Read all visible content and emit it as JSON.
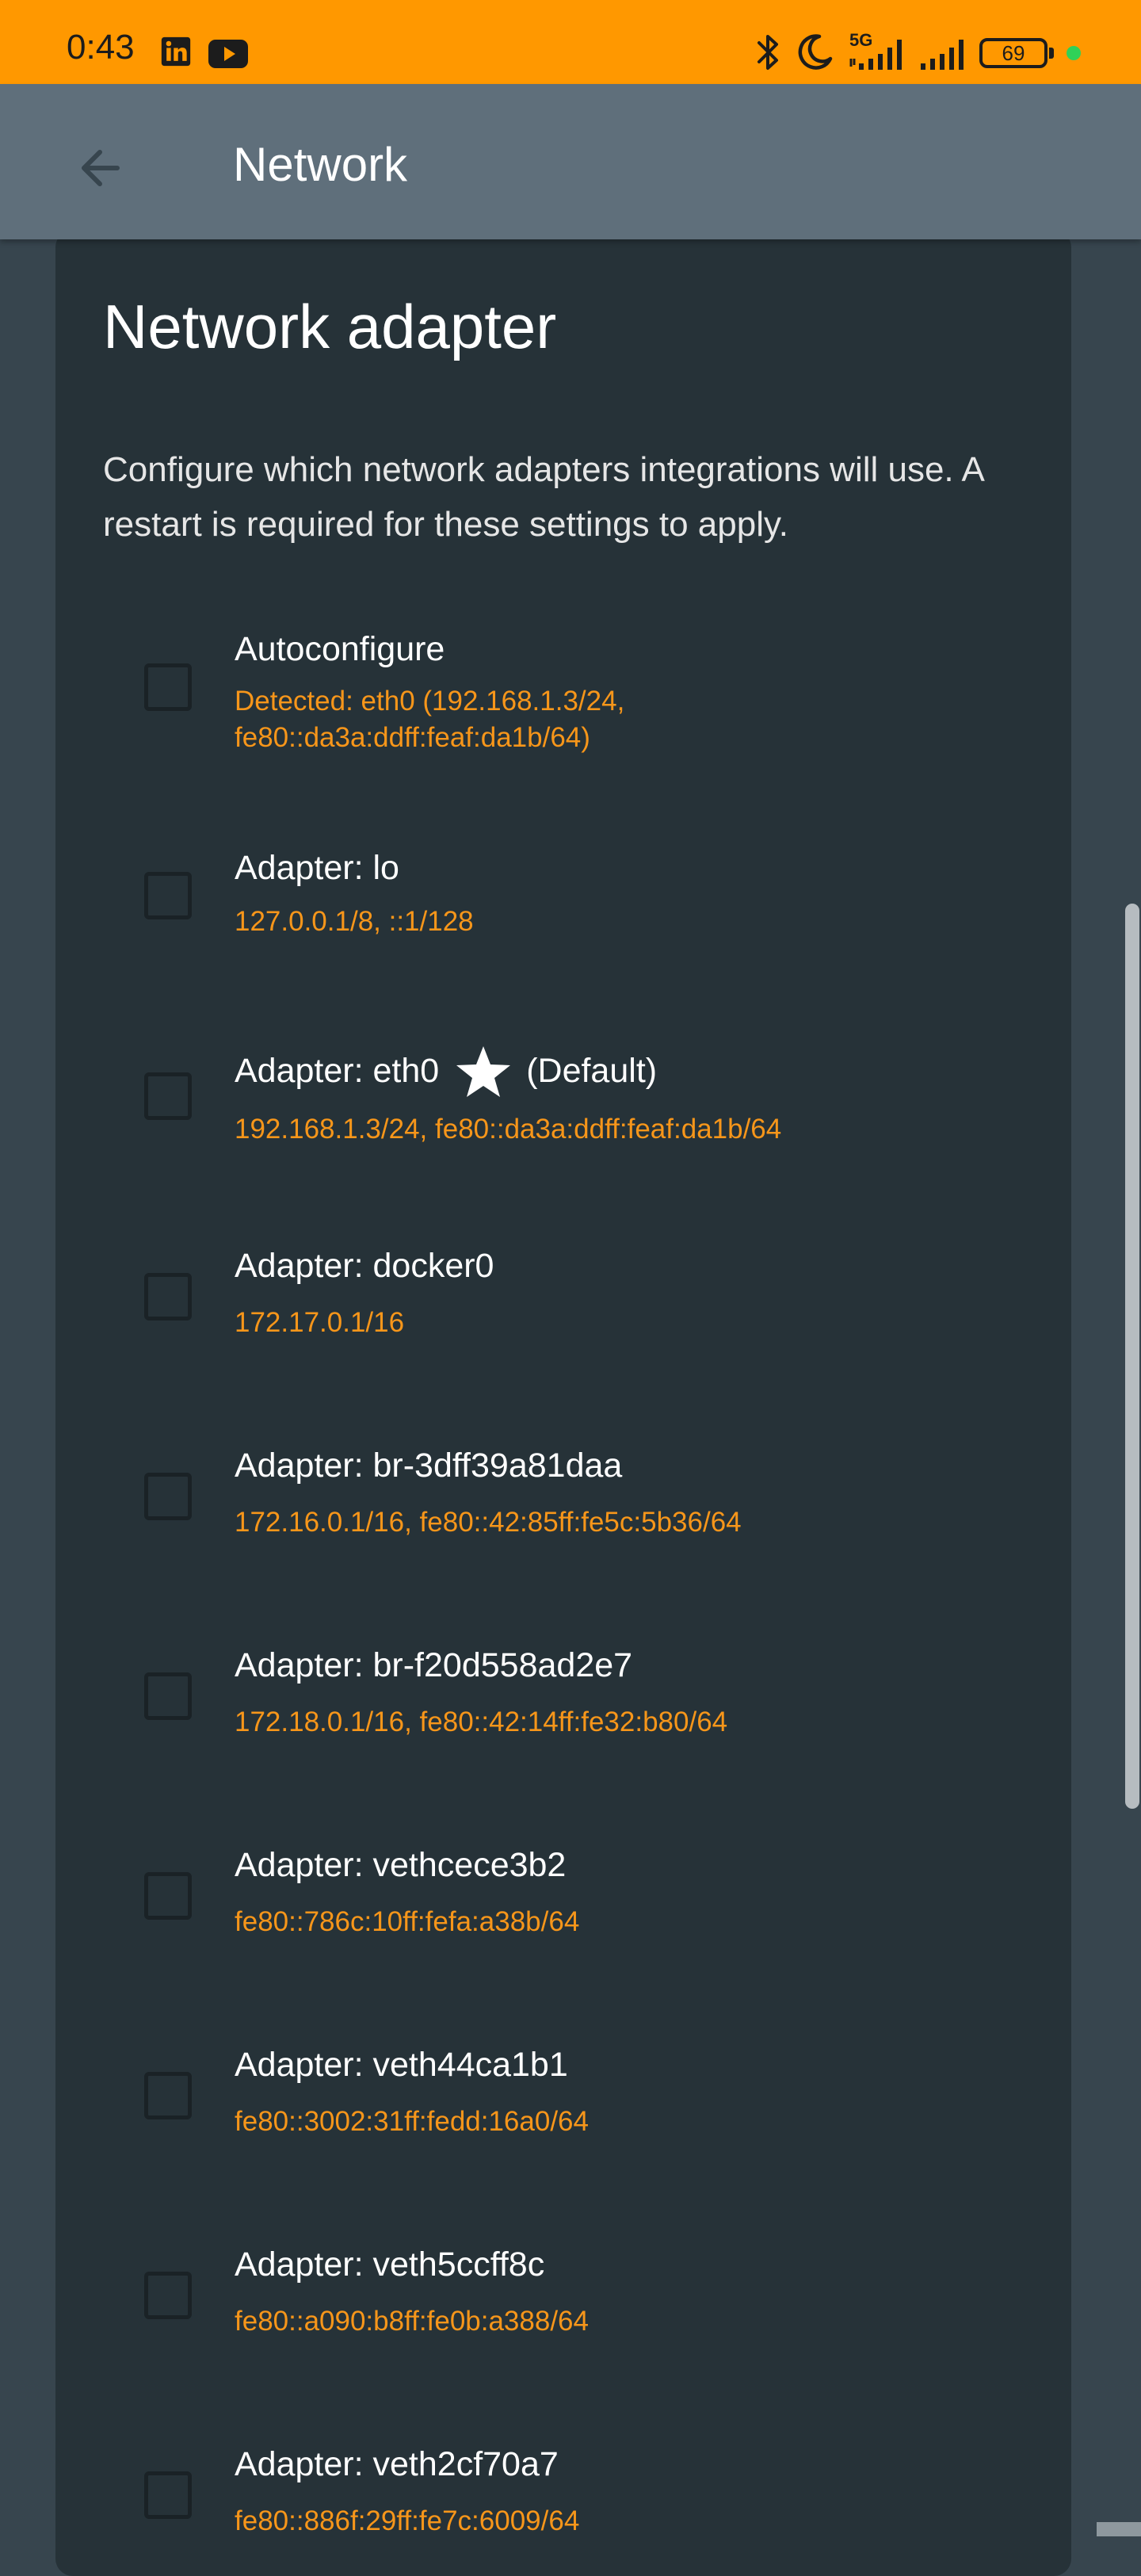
{
  "status_bar": {
    "time": "0:43",
    "battery": "69",
    "network_label": "5G",
    "icons": [
      "linkedin-icon",
      "youtube-icon",
      "bluetooth-icon",
      "do-not-disturb-icon",
      "signal-5g-icon",
      "signal-icon",
      "battery-icon",
      "privacy-dot-icon"
    ]
  },
  "app_bar": {
    "title": "Network",
    "back_icon": "arrow-left-icon"
  },
  "card": {
    "title": "Network adapter",
    "description": "Configure which network adapters integrations will use. A restart is required for these settings to apply."
  },
  "options": [
    {
      "label": "Autoconfigure",
      "sub1": "Detected: eth0 (192.168.1.3/24,",
      "sub2": "fe80::da3a:ddff:feaf:da1b/64)"
    },
    {
      "label": "Adapter: lo",
      "sub1": "127.0.0.1/8, ::1/128"
    },
    {
      "label": "Adapter: eth0",
      "default_text": "(Default)",
      "sub1": "192.168.1.3/24, fe80::da3a:ddff:feaf:da1b/64"
    },
    {
      "label": "Adapter: docker0",
      "sub1": "172.17.0.1/16"
    },
    {
      "label": "Adapter: br-3dff39a81daa",
      "sub1": "172.16.0.1/16, fe80::42:85ff:fe5c:5b36/64"
    },
    {
      "label": "Adapter: br-f20d558ad2e7",
      "sub1": "172.18.0.1/16, fe80::42:14ff:fe32:b80/64"
    },
    {
      "label": "Adapter: vethcece3b2",
      "sub1": "fe80::786c:10ff:fefa:a38b/64"
    },
    {
      "label": "Adapter: veth44ca1b1",
      "sub1": "fe80::3002:31ff:fedd:16a0/64"
    },
    {
      "label": "Adapter: veth5ccff8c",
      "sub1": "fe80::a090:b8ff:fe0b:a388/64"
    },
    {
      "label": "Adapter: veth2cf70a7",
      "sub1": "fe80::886f:29ff:fe7c:6009/64"
    }
  ],
  "colors": {
    "status_bar": "#ff9800",
    "app_bar": "#5f6f7b",
    "card": "#263238",
    "accent": "#f7961a"
  }
}
